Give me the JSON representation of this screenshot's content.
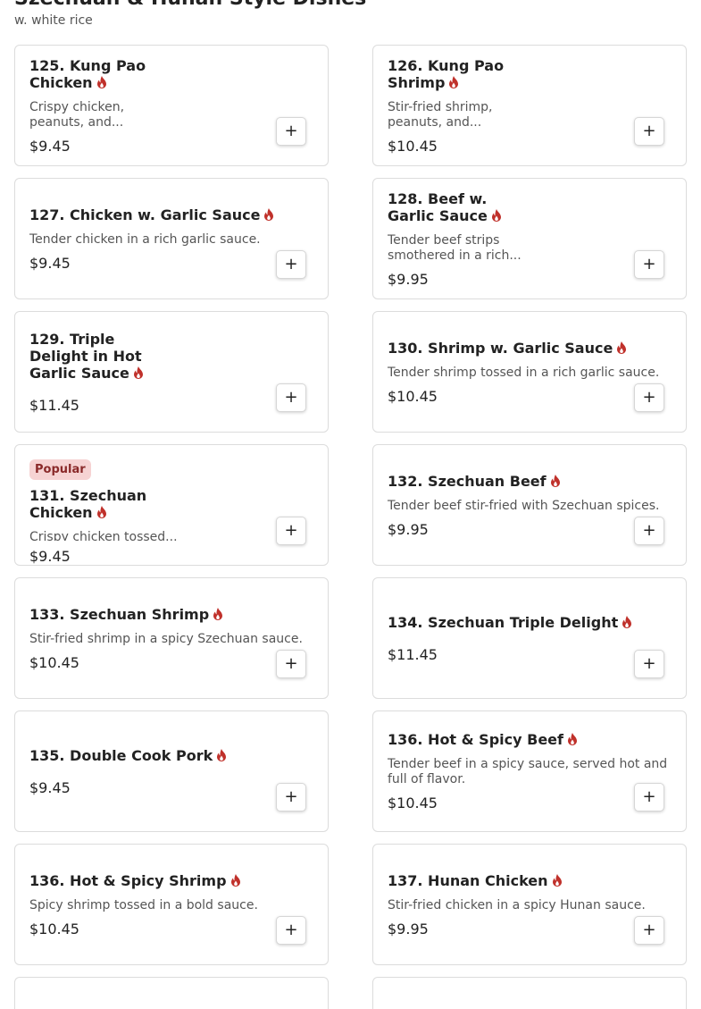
{
  "section": {
    "title": "Szechuan & Hunan Style Dishes",
    "subtitle": "w. white rice"
  },
  "colors": {
    "flame": "#c0312b",
    "badge_bg": "#f6d3d3",
    "badge_text": "#8a2a2a"
  },
  "icons": {
    "spicy": "flame-icon",
    "add": "plus-icon"
  },
  "add_label": "+",
  "items": [
    {
      "name": "125. Kung Pao Chicken",
      "desc": "Crispy chicken, peanuts, and...",
      "price": "$9.45"
    },
    {
      "name": "126. Kung Pao Shrimp",
      "desc": "Stir-fried shrimp, peanuts, and...",
      "price": "$10.45"
    },
    {
      "name": "127. Chicken w. Garlic Sauce",
      "desc": "Tender chicken in a rich garlic sauce.",
      "price": "$9.45"
    },
    {
      "name": "128. Beef w. Garlic Sauce",
      "desc": "Tender beef strips smothered in a rich...",
      "price": "$9.95"
    },
    {
      "name": "129. Triple Delight in Hot Garlic Sauce",
      "desc": "",
      "price": "$11.45"
    },
    {
      "name": "130. Shrimp w. Garlic Sauce",
      "desc": "Tender shrimp tossed in a rich garlic sauce.",
      "price": "$10.45"
    },
    {
      "name": "131. Szechuan Chicken",
      "desc": "Crispy chicken tossed...",
      "price": "$9.45",
      "badge": "Popular"
    },
    {
      "name": "132. Szechuan Beef",
      "desc": "Tender beef stir-fried with Szechuan spices.",
      "price": "$9.95"
    },
    {
      "name": "133. Szechuan Shrimp",
      "desc": "Stir-fried shrimp in a spicy Szechuan sauce.",
      "price": "$10.45"
    },
    {
      "name": "134. Szechuan Triple Delight",
      "desc": "",
      "price": "$11.45"
    },
    {
      "name": "135. Double Cook Pork",
      "desc": "",
      "price": "$9.45"
    },
    {
      "name": "136. Hot & Spicy Beef",
      "desc": "Tender beef in a spicy sauce, served hot and full of flavor.",
      "price": "$10.45"
    },
    {
      "name": "136. Hot & Spicy Shrimp",
      "desc": "Spicy shrimp tossed in a bold sauce.",
      "price": "$10.45"
    },
    {
      "name": "137. Hunan Chicken",
      "desc": "Stir-fried chicken in a spicy Hunan sauce.",
      "price": "$9.95"
    }
  ]
}
